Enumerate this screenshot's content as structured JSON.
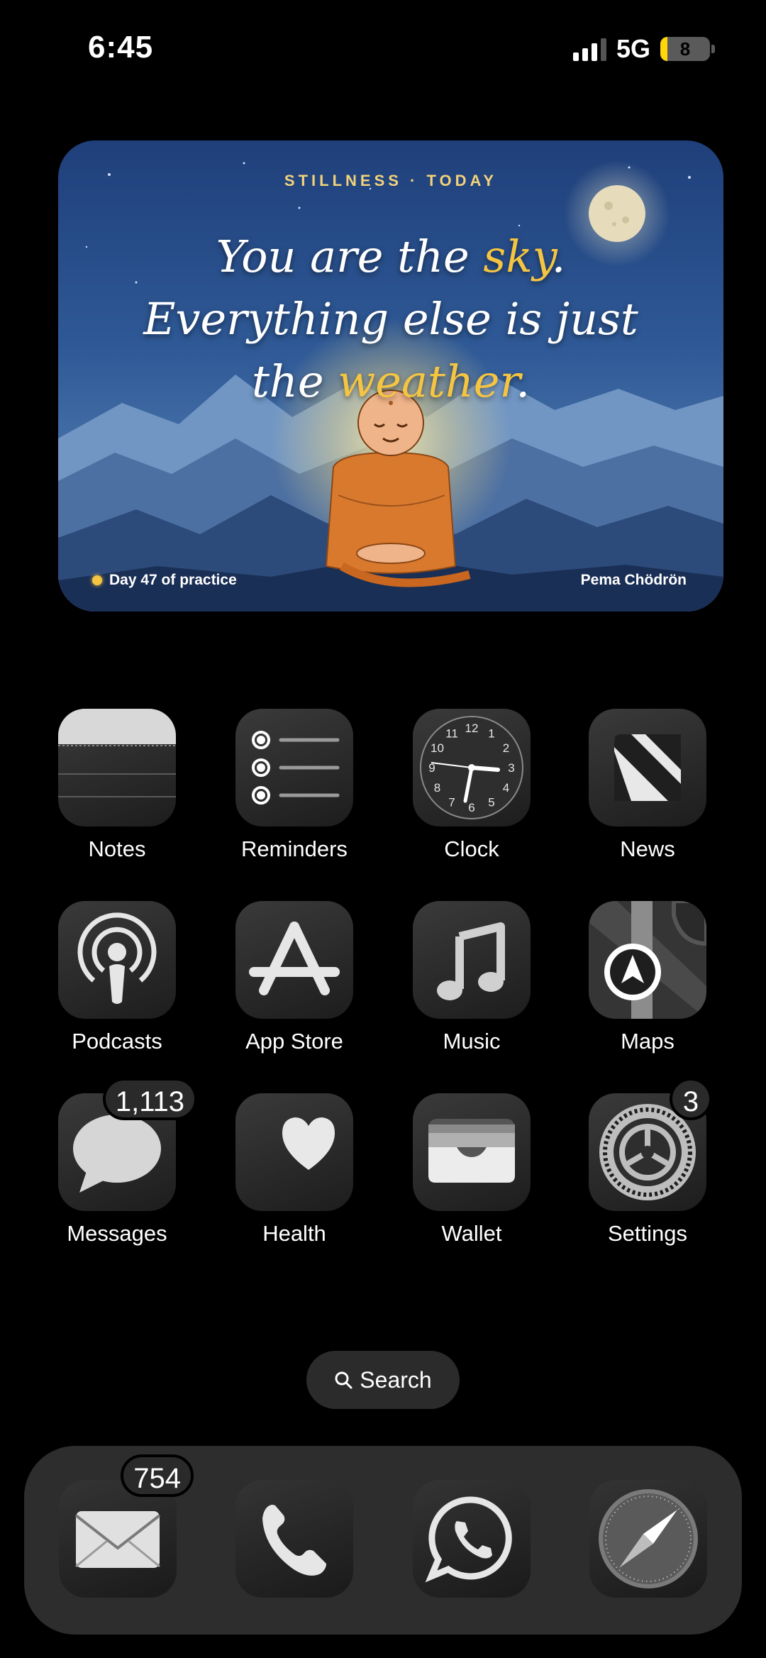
{
  "status_bar": {
    "time": "6:45",
    "network": "5G",
    "battery_level": "8",
    "signal_bars": 3,
    "battery_color": "#ffd60a"
  },
  "widget": {
    "header": "STILLNESS · TODAY",
    "quote_line1_a": "You are the ",
    "quote_line1_hl": "sky",
    "quote_line1_b": ".",
    "quote_line2": "Everything else is just",
    "quote_line3_a": "the ",
    "quote_line3_hl": "weather",
    "quote_line3_b": ".",
    "streak": "Day 47 of practice",
    "author": "Pema Chödrön",
    "highlight_color": "#f5c542"
  },
  "apps": {
    "notes": {
      "label": "Notes",
      "icon": "notes-icon"
    },
    "reminders": {
      "label": "Reminders",
      "icon": "reminders-icon"
    },
    "clock": {
      "label": "Clock",
      "icon": "clock-icon",
      "numerals": [
        "12",
        "1",
        "2",
        "3",
        "4",
        "5",
        "6",
        "7",
        "8",
        "9",
        "10",
        "11"
      ]
    },
    "news": {
      "label": "News",
      "icon": "news-icon"
    },
    "podcasts": {
      "label": "Podcasts",
      "icon": "podcasts-icon"
    },
    "app_store": {
      "label": "App Store",
      "icon": "app-store-icon"
    },
    "music": {
      "label": "Music",
      "icon": "music-note-icon"
    },
    "maps": {
      "label": "Maps",
      "icon": "maps-icon"
    },
    "messages": {
      "label": "Messages",
      "icon": "message-bubble-icon",
      "badge": "1,113"
    },
    "health": {
      "label": "Health",
      "icon": "heart-icon"
    },
    "wallet": {
      "label": "Wallet",
      "icon": "wallet-icon"
    },
    "settings": {
      "label": "Settings",
      "icon": "gear-icon",
      "badge": "3"
    }
  },
  "search": {
    "label": "Search",
    "icon": "search-icon"
  },
  "dock": {
    "mail": {
      "icon": "mail-icon",
      "badge": "754"
    },
    "phone": {
      "icon": "phone-icon"
    },
    "whatsapp": {
      "icon": "whatsapp-icon"
    },
    "safari": {
      "icon": "compass-icon"
    }
  }
}
